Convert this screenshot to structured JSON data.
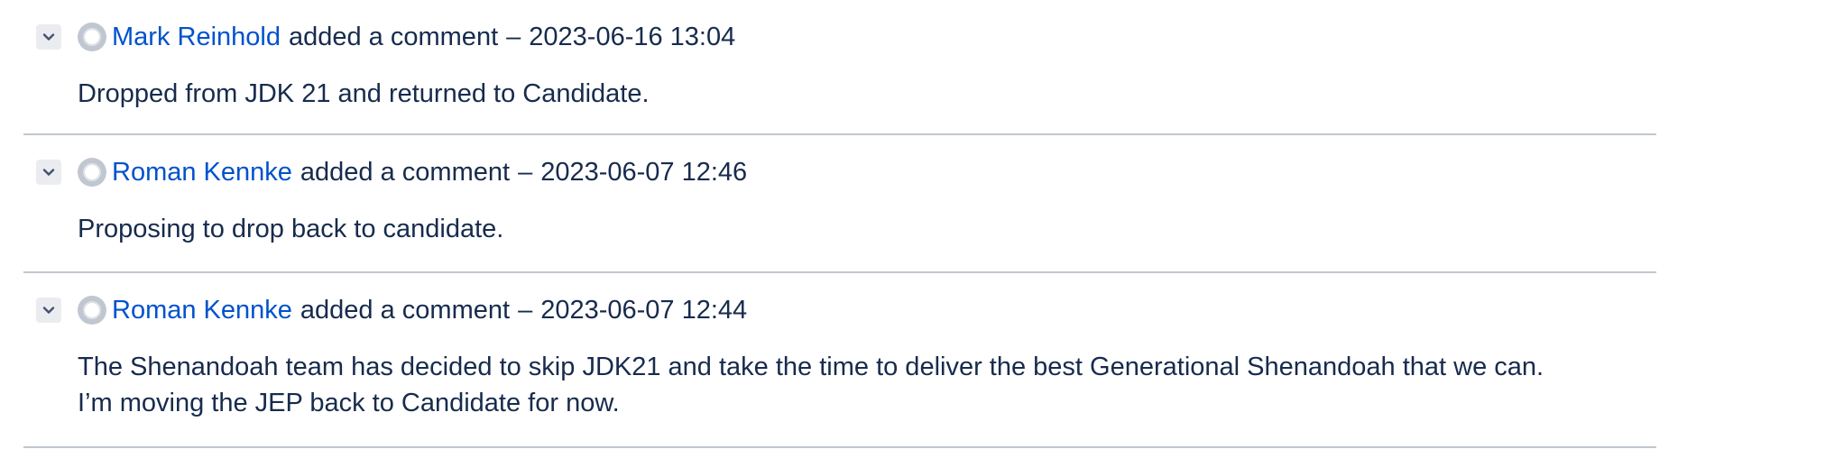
{
  "comments": [
    {
      "author": "Mark Reinhold",
      "action": "added a comment",
      "separator": "–",
      "timestamp": "2023-06-16 13:04",
      "body": [
        "Dropped from JDK 21 and returned to Candidate."
      ]
    },
    {
      "author": "Roman Kennke",
      "action": "added a comment",
      "separator": "–",
      "timestamp": "2023-06-07 12:46",
      "body": [
        "Proposing to drop back to candidate."
      ]
    },
    {
      "author": "Roman Kennke",
      "action": "added a comment",
      "separator": "–",
      "timestamp": "2023-06-07 12:44",
      "body": [
        "The Shenandoah team has decided to skip JDK21 and take the time to deliver the best Generational Shenandoah that we can.",
        "I’m moving the JEP back to Candidate for now."
      ]
    }
  ],
  "icons": {
    "toggle": "chevron-down-icon",
    "avatar": "user-avatar-icon"
  },
  "colors": {
    "link": "#0052cc",
    "text": "#172b4d",
    "divider": "#c1c7d0",
    "toggle_bg": "#ebecf0"
  }
}
